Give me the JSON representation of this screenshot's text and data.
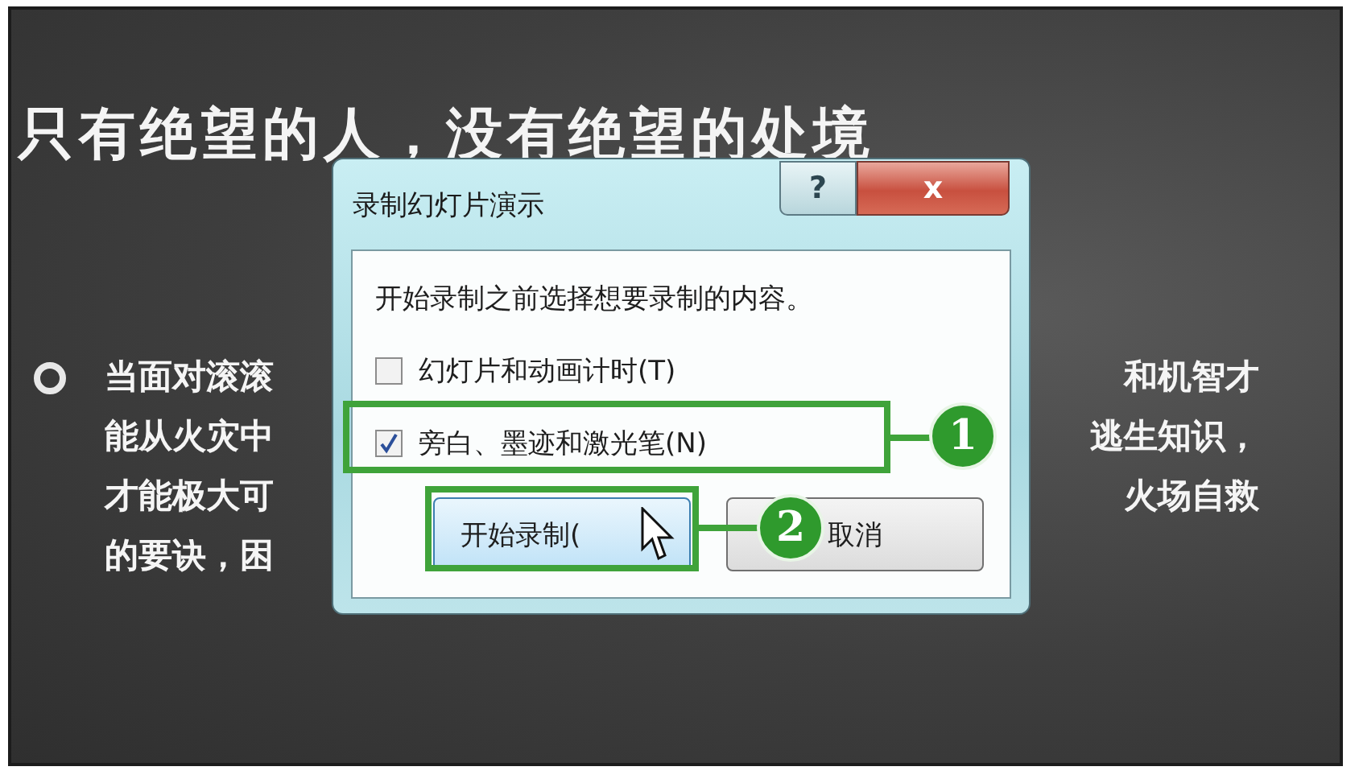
{
  "slide": {
    "title": "只有绝望的人，没有绝望的处境",
    "lines": [
      {
        "left": "当面对滚滚",
        "right": "和机智才"
      },
      {
        "left": "能从火灾中",
        "right": "逃生知识，"
      },
      {
        "left": "才能极大可",
        "right": "火场自救"
      },
      {
        "left": "的要诀，困"
      }
    ]
  },
  "dialog": {
    "title": "录制幻灯片演示",
    "help": "?",
    "close": "x",
    "prompt": "开始录制之前选择想要录制的内容。",
    "options": [
      {
        "label": "幻灯片和动画计时(T)",
        "checked": false
      },
      {
        "label": "旁白、墨迹和激光笔(N)",
        "checked": true
      }
    ],
    "buttons": [
      {
        "label": "开始录制(",
        "kind": "primary"
      },
      {
        "label": "取消",
        "kind": "normal"
      }
    ]
  },
  "callouts": [
    {
      "number": "1"
    },
    {
      "number": "2"
    }
  ]
}
